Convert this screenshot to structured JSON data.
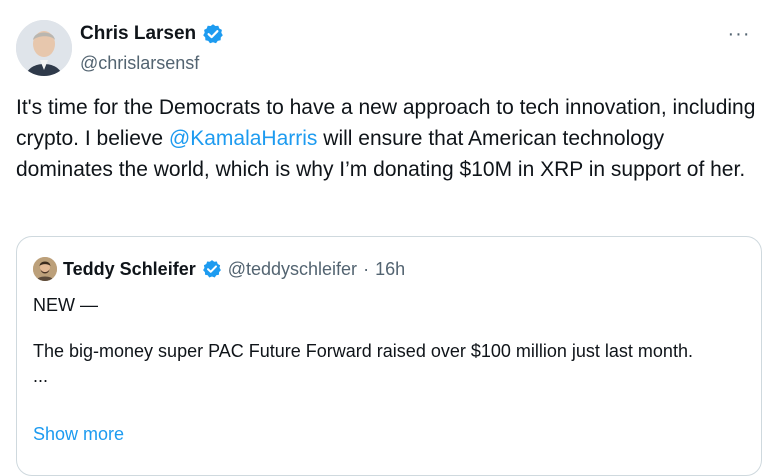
{
  "author": {
    "name": "Chris Larsen",
    "handle": "@chrislarsensf",
    "verified_color": "#1d9bf0"
  },
  "menu": {
    "more_label": "···",
    "more_icon": "more-horizontal-icon"
  },
  "tweet": {
    "text_before": "It's time for the Democrats to have a new approach to tech innovation, including crypto. I believe ",
    "mention": "@KamalaHarris",
    "text_after": " will ensure that American technology dominates the world, which is why I’m donating $10M in XRP in support of her."
  },
  "quote": {
    "name": "Teddy Schleifer",
    "handle": "@teddyschleifer",
    "separator": "·",
    "time": "16h",
    "lines": [
      "NEW —",
      "The big-money super PAC Future Forward raised over $100 million just last month.",
      "..."
    ],
    "show_more": "Show more"
  },
  "colors": {
    "link": "#1d9bf0",
    "muted": "#536471",
    "border": "#cfd9de",
    "text": "#0f1419"
  }
}
